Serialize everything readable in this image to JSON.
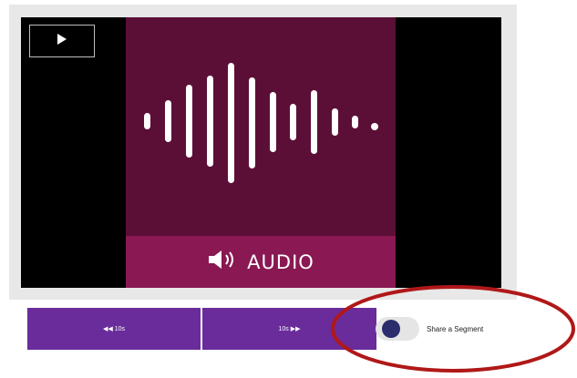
{
  "player": {
    "play_icon": "play-icon",
    "poster_label": "AUDIO",
    "poster_icon": "speaker-icon",
    "colors": {
      "poster_background": "#5b0f37",
      "poster_bar": "#8a1852",
      "letterbox": "#000000",
      "frame": "#e8e8e8"
    }
  },
  "controls": {
    "rewind_label": "◀◀ 10s",
    "forward_label": "10s ▶▶",
    "button_color": "#6a2c9b"
  },
  "share": {
    "label": "Share a Segment",
    "toggle_enabled": false,
    "knob_color": "#2b2d6c"
  },
  "annotation": {
    "shape": "ellipse",
    "color": "#b01818"
  }
}
